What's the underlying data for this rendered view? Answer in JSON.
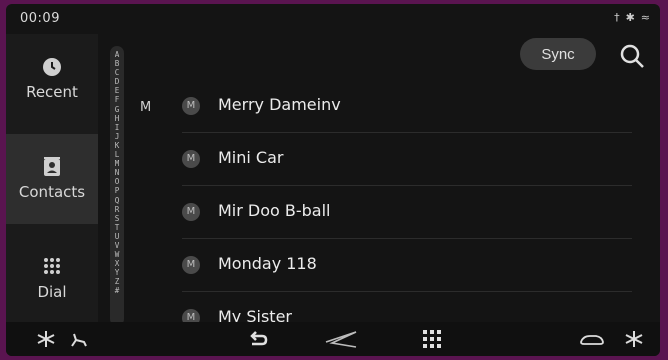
{
  "status": {
    "time": "00:09"
  },
  "sidebar": {
    "items": [
      {
        "label": "Recent"
      },
      {
        "label": "Contacts"
      },
      {
        "label": "Dial"
      }
    ]
  },
  "alphabet": "A B C D E F G H I J K L M N O P Q R S T U V W X Y Z #",
  "list": {
    "group": "M",
    "contacts": [
      {
        "initial": "M",
        "name": "Merry Dameinv"
      },
      {
        "initial": "M",
        "name": "Mini Car"
      },
      {
        "initial": "M",
        "name": "Mir Doo B-ball"
      },
      {
        "initial": "M",
        "name": "Monday 118"
      },
      {
        "initial": "M",
        "name": "My Sister"
      }
    ]
  },
  "toolbar": {
    "sync_label": "Sync"
  }
}
